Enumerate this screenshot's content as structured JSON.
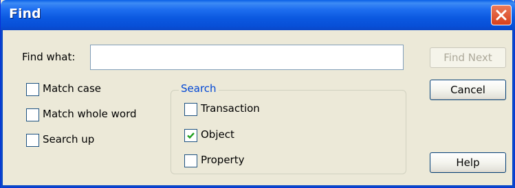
{
  "window": {
    "title": "Find"
  },
  "find": {
    "label": "Find what:",
    "value": ""
  },
  "options": {
    "match_case": {
      "label": "Match case",
      "checked": false
    },
    "match_whole_word": {
      "label": "Match whole word",
      "checked": false
    },
    "search_up": {
      "label": "Search up",
      "checked": false
    }
  },
  "search": {
    "legend": "Search",
    "transaction": {
      "label": "Transaction",
      "checked": false
    },
    "object": {
      "label": "Object",
      "checked": true
    },
    "property": {
      "label": "Property",
      "checked": false
    }
  },
  "buttons": {
    "find_next": "Find Next",
    "cancel": "Cancel",
    "help": "Help"
  }
}
